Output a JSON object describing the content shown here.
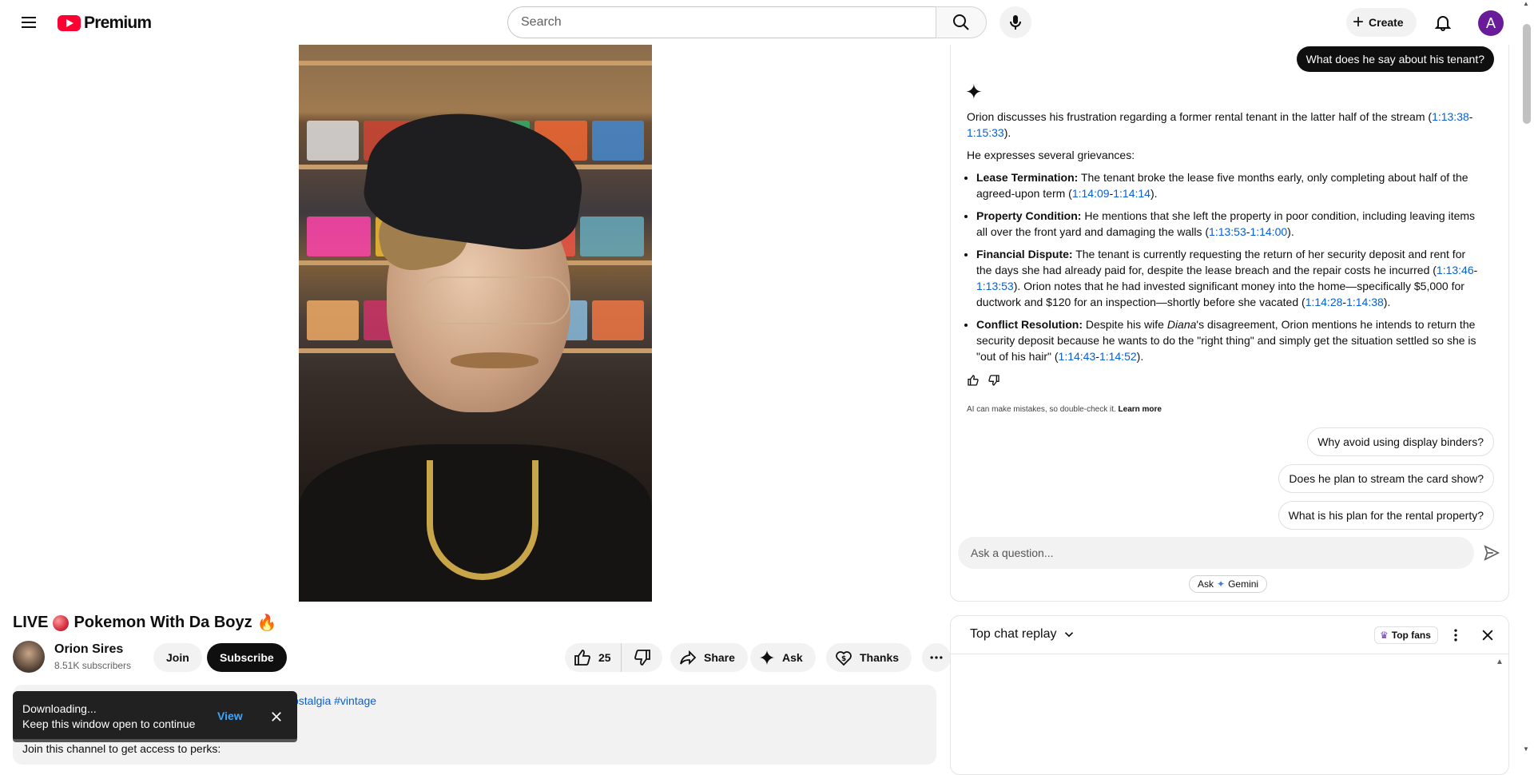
{
  "brand": {
    "logo_text": "Premium"
  },
  "search": {
    "placeholder": "Search"
  },
  "header": {
    "create_label": "Create",
    "avatar_letter": "A"
  },
  "video": {
    "title": "LIVE",
    "title_rest": "Pokemon With Da Boyz",
    "title_emoji": "🔥"
  },
  "channel": {
    "name": "Orion Sires",
    "subscribers": "8.51K subscribers",
    "join_label": "Join",
    "subscribe_label": "Subscribe"
  },
  "actions": {
    "like_count": "25",
    "share_label": "Share",
    "ask_label": "Ask",
    "thanks_label": "Thanks"
  },
  "description": {
    "tags": "ostalgia #vintage",
    "perks": "Join this channel to get access to perks:"
  },
  "toast": {
    "line1": "Downloading...",
    "line2": "Keep this window open to continue",
    "view_label": "View"
  },
  "ai": {
    "user_question": "What does he say about his tenant?",
    "intro": "Orion discusses his frustration regarding a former rental tenant in the latter half of the stream (",
    "intro_ts1": "1:13:38",
    "intro_ts2": "1:15:33",
    "intro_end": ").",
    "grievances_intro": "He expresses several grievances:",
    "items": [
      {
        "heading": "Lease Termination:",
        "text": " The tenant broke the lease five months early, only completing about half of the agreed-upon term (",
        "ts1": "1:14:09",
        "ts2": "1:14:14",
        "tail": ")."
      },
      {
        "heading": "Property Condition:",
        "text": " He mentions that she left the property in poor condition, including leaving items all over the front yard and damaging the walls (",
        "ts1": "1:13:53",
        "ts2": "1:14:00",
        "tail": ")."
      },
      {
        "heading": "Financial Dispute:",
        "text": " The tenant is currently requesting the return of her security deposit and rent for the days she had already paid for, despite the lease breach and the repair costs he incurred (",
        "ts1": "1:13:46",
        "ts2": "1:13:53",
        "middle": "). Orion notes that he had invested significant money into the home—specifically $5,000 for ductwork and $120 for an inspection—shortly before she vacated (",
        "ts3": "1:14:28",
        "ts4": "1:14:38",
        "tail": ")."
      },
      {
        "heading": "Conflict Resolution:",
        "text_a": " Despite his wife ",
        "name": "Diana",
        "text_b": "'s disagreement, Orion mentions he intends to return the security deposit because he wants to do the \"right thing\" and simply get the situation settled so she is \"out of his hair\" (",
        "ts1": "1:14:43",
        "ts2": "1:14:52",
        "tail": ")."
      }
    ],
    "disclaimer": "AI can make mistakes, so double-check it.",
    "learn_more": "Learn more",
    "suggestions": [
      "Why avoid using display binders?",
      "Does he plan to stream the card show?",
      "What is his plan for the rental property?"
    ],
    "input_placeholder": "Ask a question...",
    "ask_gemini_a": "Ask",
    "ask_gemini_b": "Gemini"
  },
  "chat": {
    "title": "Top chat replay",
    "top_fans": "Top fans"
  },
  "colors": {
    "brand_red": "#ff0033",
    "link_blue": "#065fd4",
    "toast_bg": "#212121",
    "toast_link": "#3ea6ff"
  }
}
